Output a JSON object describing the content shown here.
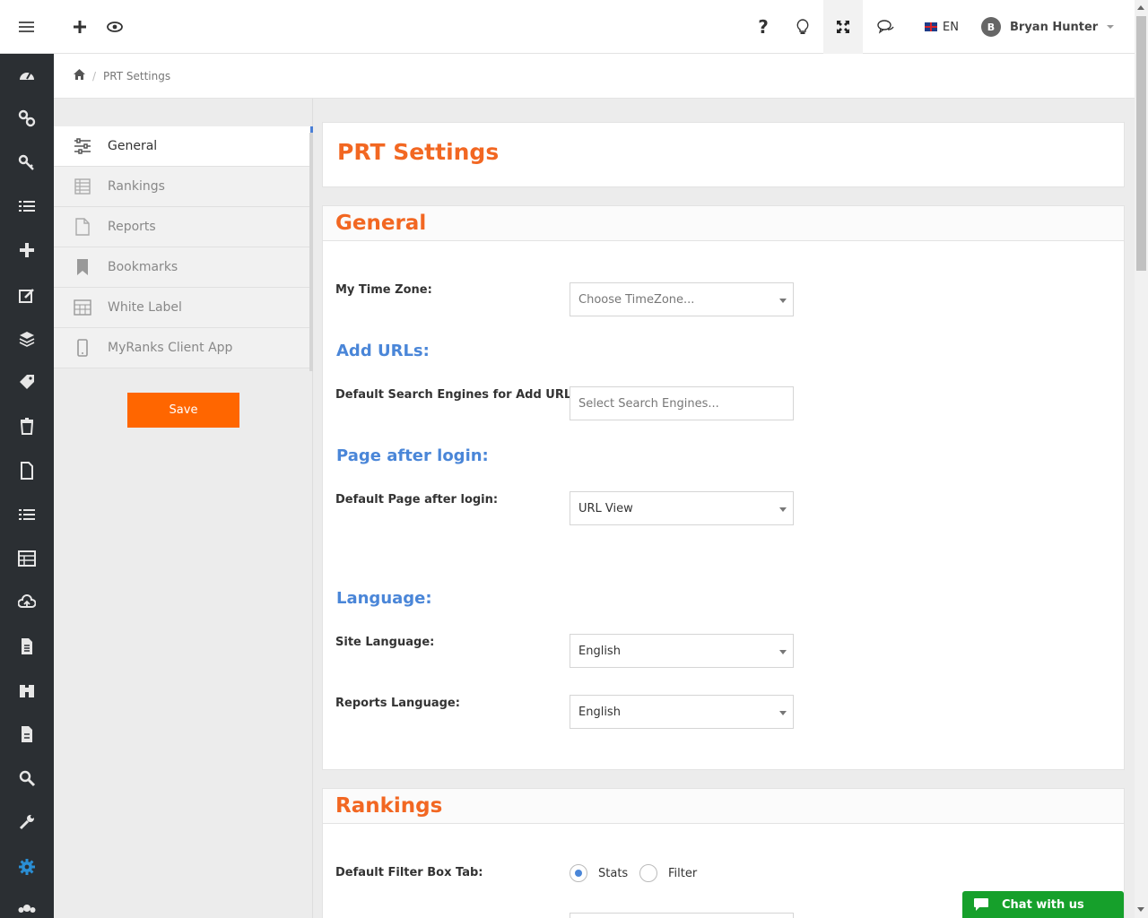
{
  "topbar": {
    "language": "EN",
    "user_initial": "B",
    "user_name": "Bryan Hunter"
  },
  "rail": {
    "icons": [
      "dashboard-icon",
      "link-icon",
      "key-icon",
      "list-icon",
      "plus-icon",
      "edit-icon",
      "layers-icon",
      "tag-icon",
      "trash-icon",
      "file-icon",
      "list-alt-icon",
      "table-icon",
      "cloud-upload-icon",
      "document-icon",
      "binoculars-icon",
      "report-icon",
      "search-icon",
      "wrench-icon",
      "settings-icon",
      "users-icon"
    ],
    "active": "settings-icon"
  },
  "breadcrumb": {
    "current": "PRT Settings"
  },
  "sidenav": {
    "items": [
      {
        "label": "General",
        "icon": "sliders-icon"
      },
      {
        "label": "Rankings",
        "icon": "table-icon"
      },
      {
        "label": "Reports",
        "icon": "file-icon"
      },
      {
        "label": "Bookmarks",
        "icon": "bookmark-icon"
      },
      {
        "label": "White Label",
        "icon": "calendar-icon"
      },
      {
        "label": "MyRanks Client App",
        "icon": "mobile-icon"
      }
    ],
    "save_label": "Save"
  },
  "page": {
    "title": "PRT Settings"
  },
  "general": {
    "heading": "General",
    "timezone_label": "My Time Zone:",
    "timezone_placeholder": "Choose TimeZone...",
    "add_urls_heading": "Add URLs:",
    "search_engines_label": "Default Search Engines for Add URL:",
    "search_engines_placeholder": "Select Search Engines...",
    "page_after_login_heading": "Page after login:",
    "default_page_label": "Default Page after login:",
    "default_page_value": "URL View",
    "language_heading": "Language:",
    "site_language_label": "Site Language:",
    "site_language_value": "English",
    "reports_language_label": "Reports Language:",
    "reports_language_value": "English"
  },
  "rankings": {
    "heading": "Rankings",
    "filter_tab_label": "Default Filter Box Tab:",
    "options": [
      "Stats",
      "Filter"
    ],
    "selected": "Stats"
  },
  "chat": {
    "label": "Chat with us"
  },
  "colors": {
    "accent": "#f26722",
    "link": "#4a86d8",
    "rail": "#2b2f33",
    "save": "#ff6600",
    "chat": "#16a02b"
  }
}
